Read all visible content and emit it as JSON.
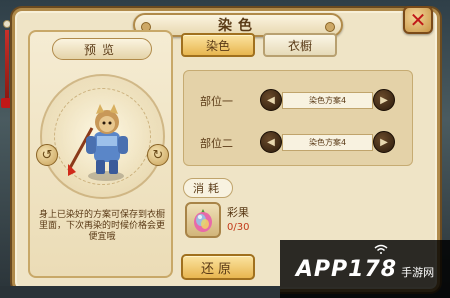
{
  "window": {
    "title": "染色",
    "close_glyph": "✕"
  },
  "preview": {
    "label": "预览",
    "note": "身上已染好的方案可保存到衣橱里面，下次再染的时候价格会更便宜哦"
  },
  "tabs": [
    {
      "label": "染色",
      "active": true
    },
    {
      "label": "衣橱",
      "active": false
    }
  ],
  "parts": [
    {
      "label": "部位一",
      "scheme": "染色方案4"
    },
    {
      "label": "部位二",
      "scheme": "染色方案4"
    }
  ],
  "consume": {
    "label": "消耗",
    "item_name": "彩果",
    "item_count": "0/30",
    "item_icon": "rainbow-fruit-icon"
  },
  "restore_label": "还原",
  "watermark": {
    "text": "APP178",
    "sub": "手游网"
  },
  "colors": {
    "panel_bg": "#efe4c6",
    "gold_button": "#e8b650",
    "close_red": "#c01818",
    "count_red": "#c23a1a"
  }
}
